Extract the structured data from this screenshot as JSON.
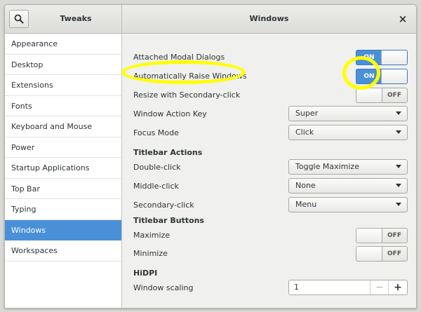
{
  "app": {
    "title": "Tweaks"
  },
  "page": {
    "title": "Windows",
    "close_glyph": "×"
  },
  "sidebar": {
    "items": [
      {
        "label": "Appearance"
      },
      {
        "label": "Desktop"
      },
      {
        "label": "Extensions"
      },
      {
        "label": "Fonts"
      },
      {
        "label": "Keyboard and Mouse"
      },
      {
        "label": "Power"
      },
      {
        "label": "Startup Applications"
      },
      {
        "label": "Top Bar"
      },
      {
        "label": "Typing"
      },
      {
        "label": "Windows",
        "selected": true
      },
      {
        "label": "Workspaces"
      }
    ]
  },
  "settings": {
    "attached_modal": {
      "label": "Attached Modal Dialogs",
      "state": "ON"
    },
    "auto_raise": {
      "label": "Automatically Raise Windows",
      "state": "ON"
    },
    "resize_secondary": {
      "label": "Resize with Secondary-click",
      "state": "OFF"
    },
    "window_action_key": {
      "label": "Window Action Key",
      "value": "Super"
    },
    "focus_mode": {
      "label": "Focus Mode",
      "value": "Click"
    }
  },
  "titlebar_actions": {
    "heading": "Titlebar Actions",
    "double_click": {
      "label": "Double-click",
      "value": "Toggle Maximize"
    },
    "middle_click": {
      "label": "Middle-click",
      "value": "None"
    },
    "secondary_click": {
      "label": "Secondary-click",
      "value": "Menu"
    }
  },
  "titlebar_buttons": {
    "heading": "Titlebar Buttons",
    "maximize": {
      "label": "Maximize",
      "state": "OFF"
    },
    "minimize": {
      "label": "Minimize",
      "state": "OFF"
    }
  },
  "hidpi": {
    "heading": "HiDPI",
    "window_scaling": {
      "label": "Window scaling",
      "value": "1",
      "minus": "−",
      "plus": "+"
    }
  },
  "colors": {
    "accent": "#4a90d9",
    "highlight": "#ffff00"
  },
  "icons": {
    "search": "search-icon",
    "close": "close-icon",
    "dropdown": "chevron-down-icon"
  }
}
